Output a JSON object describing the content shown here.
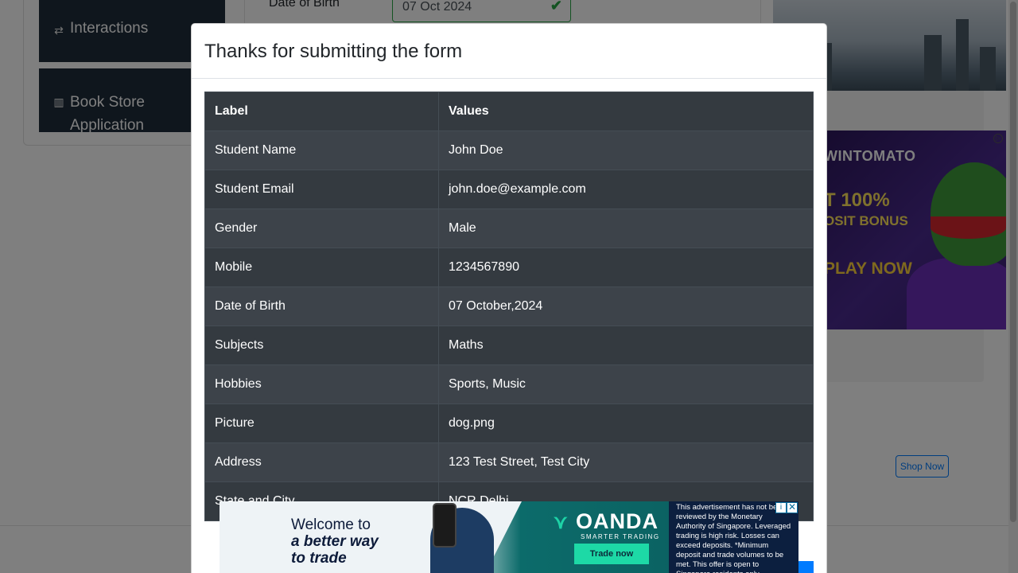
{
  "sidebar": {
    "items": [
      {
        "label": "Interactions",
        "icon": "interactions-icon"
      },
      {
        "label": "Book Store Application",
        "icon": "book-store-icon"
      }
    ]
  },
  "form": {
    "dob_label": "Date of Birth",
    "dob_value": "07 Oct 2024"
  },
  "right_ads": {
    "game_brand": "WINTOMATO",
    "game_bonus_line1": "T 100%",
    "game_bonus_line2": "OSIT BONUS",
    "game_cta": "PLAY NOW",
    "shop_now": "Shop Now"
  },
  "modal": {
    "title": "Thanks for submitting the form",
    "table": {
      "headers": [
        "Label",
        "Values"
      ],
      "rows": [
        {
          "label": "Student Name",
          "value": "John Doe"
        },
        {
          "label": "Student Email",
          "value": "john.doe@example.com"
        },
        {
          "label": "Gender",
          "value": "Male"
        },
        {
          "label": "Mobile",
          "value": "1234567890"
        },
        {
          "label": "Date of Birth",
          "value": "07 October,2024"
        },
        {
          "label": "Subjects",
          "value": "Maths"
        },
        {
          "label": "Hobbies",
          "value": "Sports, Music"
        },
        {
          "label": "Picture",
          "value": "dog.png"
        },
        {
          "label": "Address",
          "value": "123 Test Street, Test City"
        },
        {
          "label": "State and City",
          "value": "NCR Delhi"
        }
      ]
    }
  },
  "bottom_ad": {
    "headline_line1": "Welcome to",
    "headline_line2": "a better way",
    "headline_line3": "to trade",
    "brand": "OANDA",
    "tagline": "SMARTER TRADING",
    "cta": "Trade now",
    "disclaimer": "This advertisement has not been reviewed by the Monetary Authority of Singapore. Leveraged trading is high risk. Losses can exceed deposits. *Minimum deposit and trade volumes to be met. This offer is open to Singapore residents only.",
    "info_symbol": "i",
    "close_symbol": "✕"
  },
  "colors": {
    "sidebar_bg": "#1f2c3a",
    "table_bg": "#343a40",
    "success": "#28a745",
    "primary": "#007bff"
  }
}
